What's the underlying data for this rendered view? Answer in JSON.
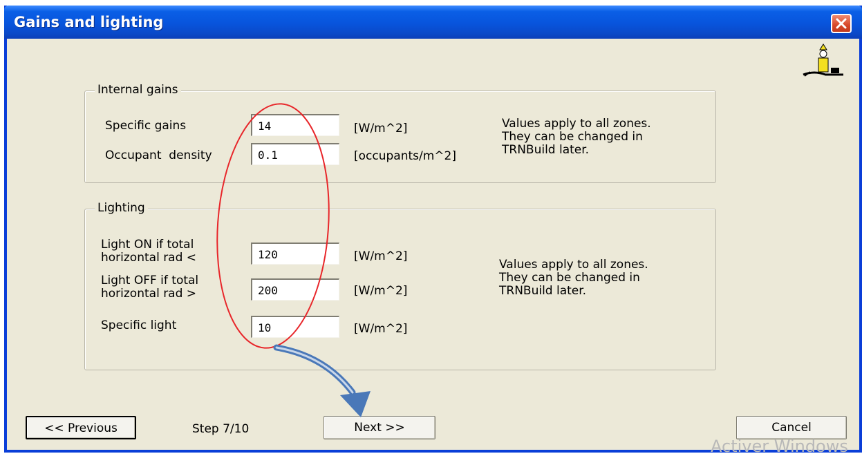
{
  "window": {
    "title": "Gains and lighting"
  },
  "internal_gains": {
    "legend": "Internal gains",
    "rows": [
      {
        "label": "Specific gains",
        "value": "14",
        "unit": "[W/m^2]"
      },
      {
        "label": "Occupant  density",
        "value": "0.1",
        "unit": "[occupants/m^2]"
      }
    ],
    "note_lines": [
      "Values apply to all zones.",
      "They can be changed in",
      "TRNBuild later."
    ]
  },
  "lighting": {
    "legend": "Lighting",
    "rows": [
      {
        "label_lines": [
          "Light ON if total",
          "horizontal rad <"
        ],
        "value": "120",
        "unit": "[W/m^2]"
      },
      {
        "label_lines": [
          "Light OFF if total",
          "horizontal rad >"
        ],
        "value": "200",
        "unit": "[W/m^2]"
      },
      {
        "label": "Specific light",
        "value": "10",
        "unit": "[W/m^2]"
      }
    ],
    "note_lines": [
      "Values apply to all zones.",
      "They can be changed in",
      "TRNBuild later."
    ]
  },
  "footer": {
    "previous_label": "<< Previous",
    "step_label": "Step 7/10",
    "next_label": "Next >>",
    "cancel_label": "Cancel"
  },
  "watermark": "Activer Windows",
  "colors": {
    "titlebar": "#0854dc",
    "dialog_bg": "#ece9d8",
    "annotation_ellipse": "#e8262a",
    "annotation_arrow": "#4a78b8"
  },
  "icons": [
    "close-icon",
    "wizard-icon"
  ]
}
